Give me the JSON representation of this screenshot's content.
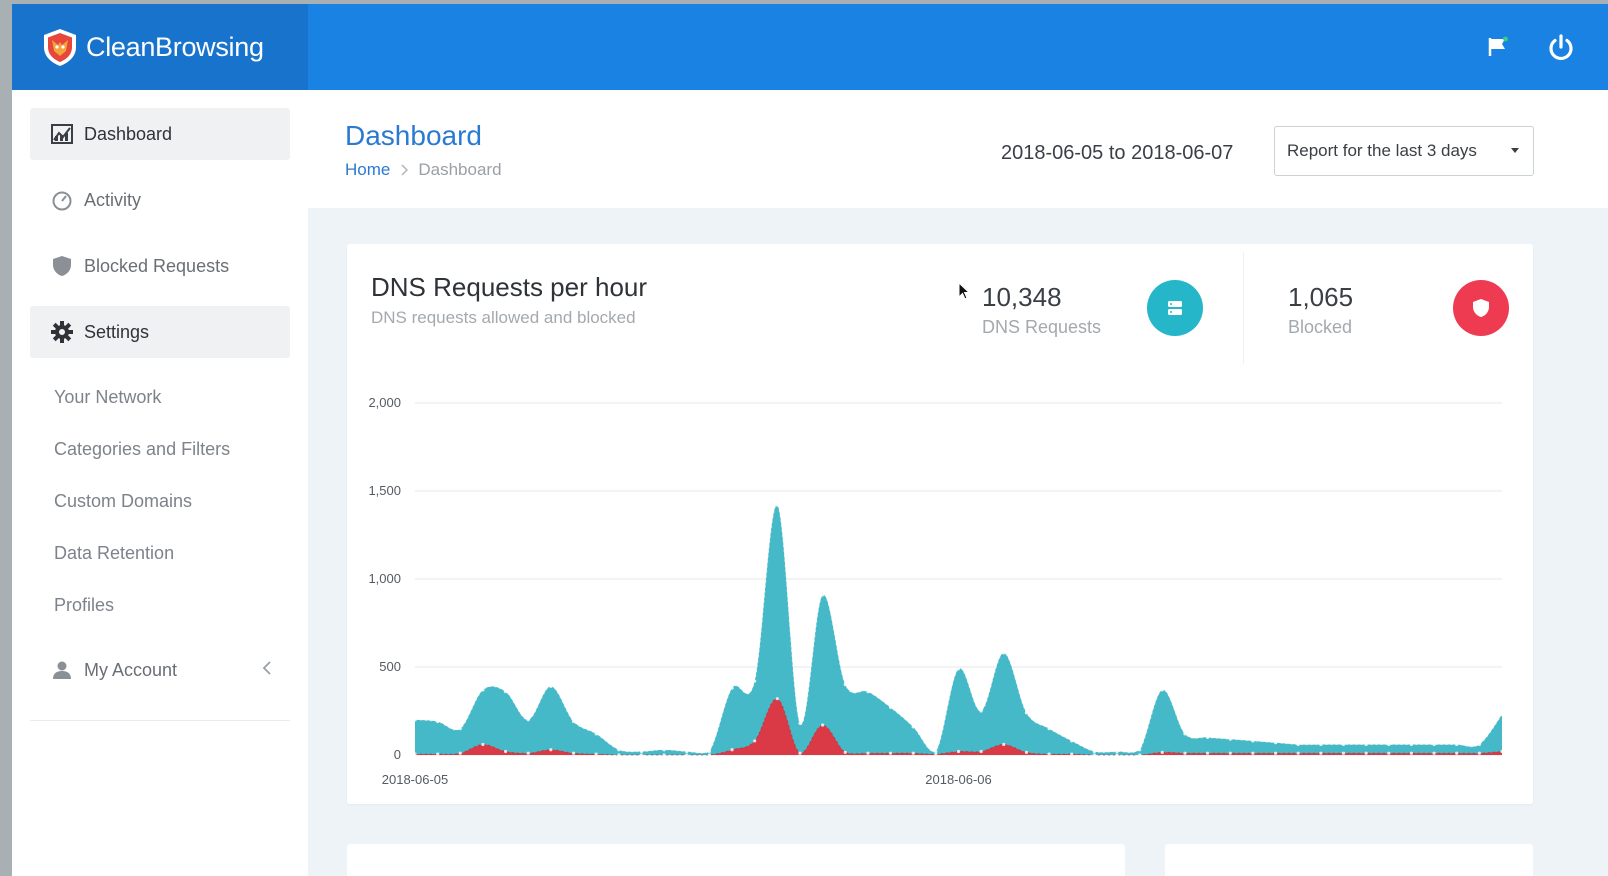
{
  "brand": {
    "name": "CleanBrowsing"
  },
  "header": {
    "icons": [
      "flag-icon",
      "power-icon"
    ]
  },
  "sidebar": {
    "items": [
      {
        "label": "Dashboard",
        "icon": "chart-icon",
        "active": true
      },
      {
        "label": "Activity",
        "icon": "gauge-icon",
        "active": false
      },
      {
        "label": "Blocked Requests",
        "icon": "shield-icon",
        "active": false
      },
      {
        "label": "Settings",
        "icon": "gear-icon",
        "active": true
      }
    ],
    "settings_sub": [
      "Your Network",
      "Categories and Filters",
      "Custom Domains",
      "Data Retention",
      "Profiles"
    ],
    "account": {
      "label": "My Account",
      "icon": "user-icon"
    }
  },
  "page": {
    "title": "Dashboard",
    "breadcrumb": {
      "home": "Home",
      "current": "Dashboard"
    },
    "date_range": "2018-06-05 to 2018-06-07",
    "report_select": "Report for the last 3 days"
  },
  "card": {
    "title": "DNS Requests per hour",
    "subtitle": "DNS requests allowed and blocked",
    "stats": [
      {
        "value": "10,348",
        "label": "DNS Requests",
        "color": "#26b6c9",
        "icon": "server-icon"
      },
      {
        "value": "1,065",
        "label": "Blocked",
        "color": "#ee3b51",
        "icon": "shield-icon"
      }
    ]
  },
  "colors": {
    "accent": "#1a82e2",
    "allowed": "#3bb5c4",
    "blocked": "#e3323f"
  },
  "chart_data": {
    "type": "area",
    "title": "",
    "xlabel": "",
    "ylabel": "",
    "ylim": [
      0,
      2000
    ],
    "yticks": [
      "0",
      "500",
      "1,000",
      "1,500",
      "2,000"
    ],
    "xticks": [
      {
        "label": "2018-06-05",
        "x": 0
      },
      {
        "label": "2018-06-06",
        "x": 24
      }
    ],
    "grid": true,
    "x": [
      0,
      1,
      2,
      3,
      4,
      5,
      6,
      7,
      8,
      9,
      10,
      11,
      12,
      13,
      14,
      15,
      16,
      17,
      18,
      19,
      20,
      21,
      22,
      23,
      24,
      25,
      26,
      27,
      28,
      29,
      30,
      31,
      32,
      33,
      34,
      35,
      36,
      37,
      38,
      39,
      40,
      41,
      42,
      43,
      44,
      45,
      46,
      47,
      48
    ],
    "series": [
      {
        "values": [
          200,
          190,
          150,
          370,
          360,
          200,
          390,
          190,
          120,
          30,
          20,
          30,
          20,
          20,
          380,
          420,
          1420,
          180,
          910,
          400,
          360,
          270,
          160,
          20,
          490,
          250,
          580,
          240,
          150,
          80,
          20,
          20,
          30,
          370,
          120,
          100,
          90,
          80,
          70,
          60,
          60,
          60,
          60,
          60,
          60,
          60,
          60,
          60,
          230
        ],
        "color": "#3bb5c4"
      },
      {
        "values": [
          5,
          5,
          10,
          60,
          20,
          10,
          30,
          10,
          5,
          0,
          0,
          0,
          0,
          0,
          30,
          80,
          320,
          10,
          170,
          15,
          10,
          10,
          10,
          5,
          20,
          20,
          60,
          15,
          5,
          5,
          0,
          0,
          0,
          15,
          10,
          10,
          10,
          10,
          10,
          10,
          10,
          10,
          10,
          10,
          10,
          10,
          10,
          10,
          20
        ],
        "color": "#e3323f"
      }
    ]
  }
}
